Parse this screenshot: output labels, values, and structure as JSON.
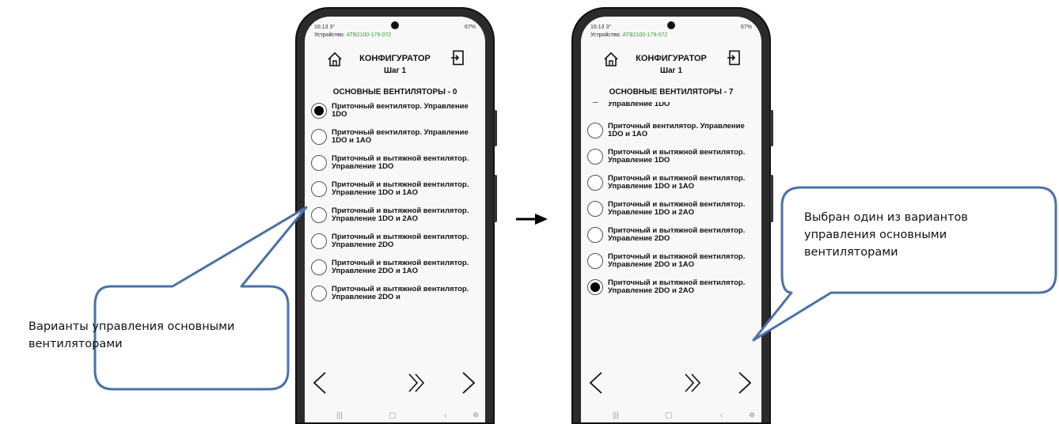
{
  "status": {
    "time": "16:13 3°",
    "system": "67%"
  },
  "device": {
    "label": "Устройство:",
    "id": "ATB2100-179-072"
  },
  "header": {
    "title": "КОНФИГУРАТОР",
    "step": "Шаг 1"
  },
  "left_phone": {
    "section": "ОСНОВНЫЕ ВЕНТИЛЯТОРЫ - 0",
    "options": [
      {
        "text": "Приточный вентилятор. Управление 1DO",
        "selected": true
      },
      {
        "text": "Приточный вентилятор. Управление 1DO и 1AO",
        "selected": false
      },
      {
        "text": "Приточный и вытяжной вентилятор. Управление 1DO",
        "selected": false
      },
      {
        "text": "Приточный и вытяжной вентилятор. Управление 1DO и 1AO",
        "selected": false
      },
      {
        "text": "Приточный и вытяжной вентилятор. Управление 1DO и 2AO",
        "selected": false
      },
      {
        "text": "Приточный и вытяжной вентилятор. Управление 2DO",
        "selected": false
      },
      {
        "text": "Приточный и вытяжной вентилятор. Управление 2DO и 1AO",
        "selected": false
      },
      {
        "text": "Приточный и вытяжной вентилятор. Управление 2DO и",
        "selected": false
      }
    ]
  },
  "right_phone": {
    "section": "ОСНОВНЫЕ ВЕНТИЛЯТОРЫ - 7",
    "options": [
      {
        "text": "Управление 1DO",
        "selected": false
      },
      {
        "text": "Приточный вентилятор. Управление 1DO и 1AO",
        "selected": false
      },
      {
        "text": "Приточный и вытяжной вентилятор. Управление 1DO",
        "selected": false
      },
      {
        "text": "Приточный и вытяжной вентилятор. Управление 1DO и 1AO",
        "selected": false
      },
      {
        "text": "Приточный и вытяжной вентилятор. Управление 1DO и 2AO",
        "selected": false
      },
      {
        "text": "Приточный и вытяжной вентилятор. Управление 2DO",
        "selected": false
      },
      {
        "text": "Приточный и вытяжной вентилятор. Управление 2DO и 1AO",
        "selected": false
      },
      {
        "text": "Приточный и вытяжной вентилятор. Управление 2DO и 2AO",
        "selected": true
      }
    ]
  },
  "nav": {
    "prev": "‹",
    "skip": "»",
    "next": "›"
  },
  "callouts": {
    "left": "Варианты управления основными вентиляторами",
    "right": "Выбран один из вариантов управления основными вентиляторами"
  },
  "colors": {
    "callout_border": "#4a72a8",
    "device_id": "#3a9a3a",
    "phone_frame": "#2b2b2b"
  }
}
